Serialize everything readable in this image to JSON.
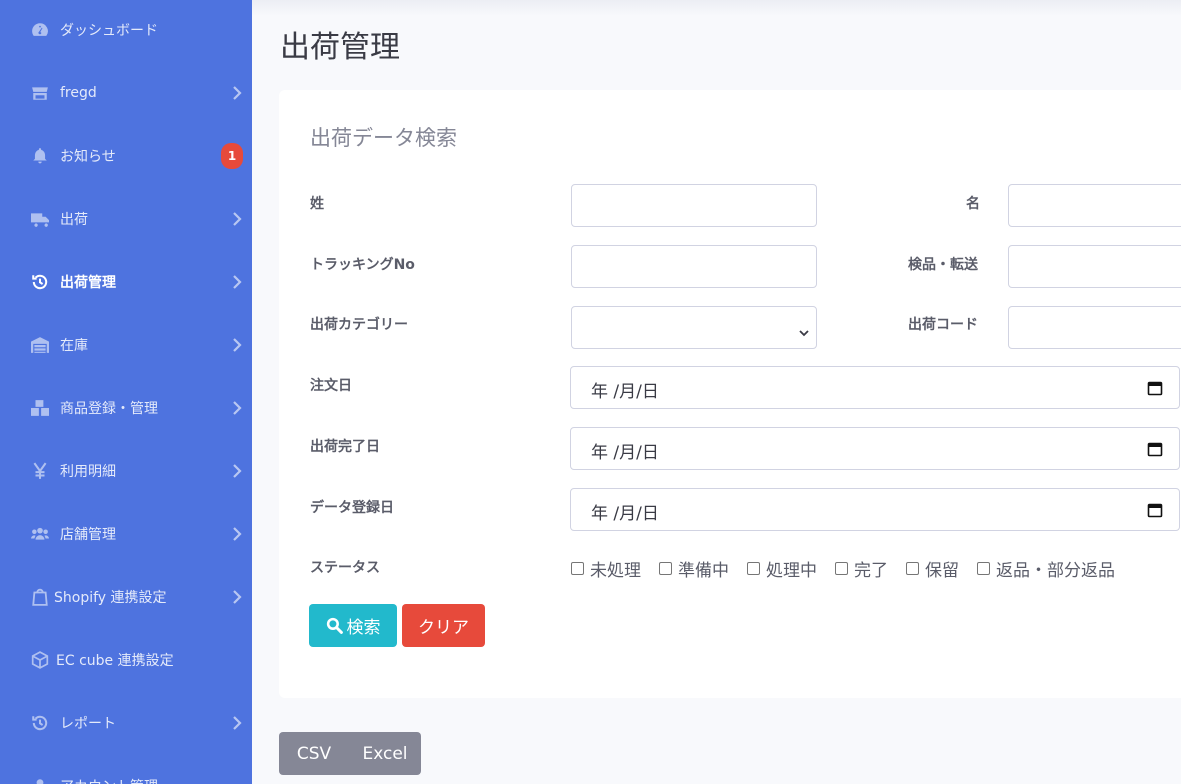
{
  "sidebar": {
    "items": [
      {
        "label": "ダッシュボード",
        "icon": "dashboard-icon",
        "chevron": false
      },
      {
        "label": "fregd",
        "icon": "store-icon",
        "chevron": true
      },
      {
        "label": "お知らせ",
        "icon": "bell-icon",
        "chevron": false,
        "badge": "1"
      },
      {
        "label": "出荷",
        "icon": "truck-icon",
        "chevron": true
      },
      {
        "label": "出荷管理",
        "icon": "history-icon",
        "chevron": true,
        "active": true
      },
      {
        "label": "在庫",
        "icon": "warehouse-icon",
        "chevron": true
      },
      {
        "label": "商品登録・管理",
        "icon": "boxes-icon",
        "chevron": true
      },
      {
        "label": "利用明細",
        "icon": "yen-icon",
        "chevron": true
      },
      {
        "label": "店舗管理",
        "icon": "users-icon",
        "chevron": true
      },
      {
        "label": "Shopify 連携設定",
        "icon": "shopify-bag-icon",
        "chevron": true
      },
      {
        "label": "EC cube 連携設定",
        "icon": "cube-icon",
        "chevron": false
      },
      {
        "label": "レポート",
        "icon": "history-icon",
        "chevron": true
      },
      {
        "label": "アカウント管理",
        "icon": "user-icon",
        "chevron": false
      }
    ]
  },
  "page": {
    "title": "出荷管理"
  },
  "search": {
    "title": "出荷データ検索",
    "last_name_label": "姓",
    "first_name_label": "名",
    "tracking_label": "トラッキングNo",
    "inspect_label": "検品・転送",
    "category_label": "出荷カテゴリー",
    "ship_code_label": "出荷コード",
    "order_date_label": "注文日",
    "ship_done_label": "出荷完了日",
    "register_date_label": "データ登録日",
    "status_label": "ステータス",
    "date_placeholder": "年 /月/日",
    "statuses": [
      "未処理",
      "準備中",
      "処理中",
      "完了",
      "保留",
      "返品・部分返品"
    ],
    "search_button": "検索",
    "clear_button": "クリア"
  },
  "export": {
    "csv": "CSV",
    "excel": "Excel"
  },
  "colors": {
    "sidebar": "#4e73df",
    "info": "#22b9cc",
    "danger": "#e74a3b",
    "secondary": "#858796"
  }
}
